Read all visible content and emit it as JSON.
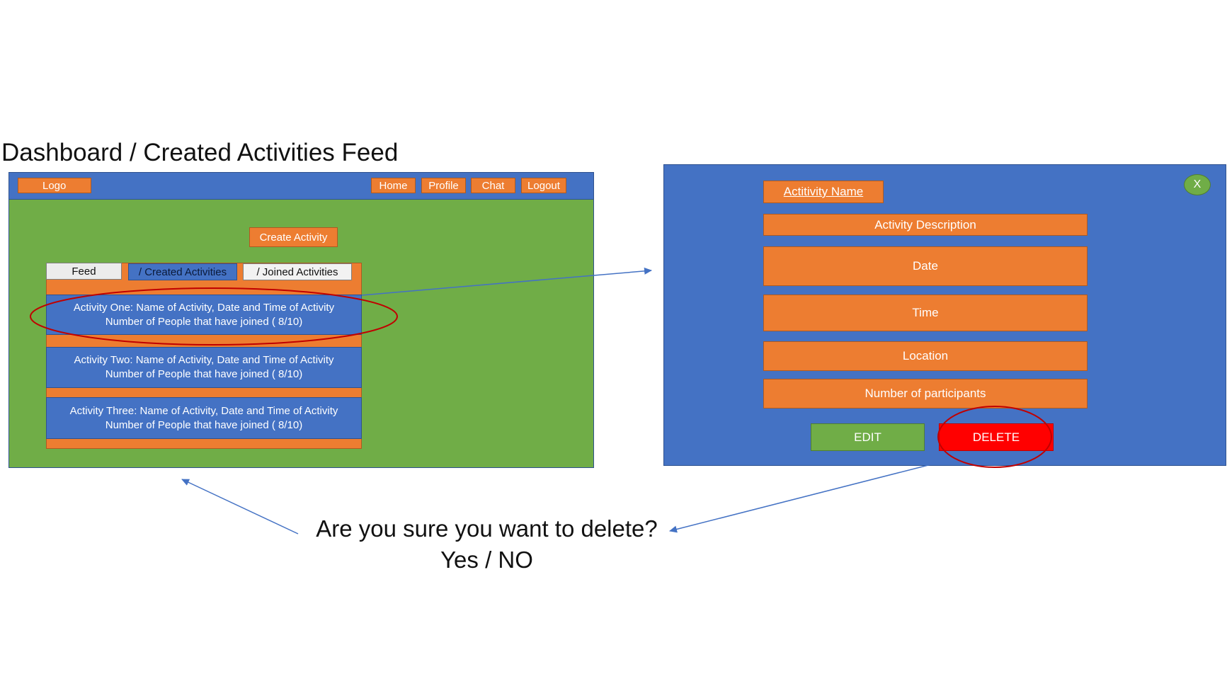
{
  "page_title": "Dashboard / Created Activities Feed",
  "dashboard": {
    "nav": {
      "logo": "Logo",
      "home": "Home",
      "profile": "Profile",
      "chat": "Chat",
      "logout": "Logout"
    },
    "create_activity": "Create Activity",
    "tabs": {
      "feed": "Feed",
      "created": "/ Created Activities",
      "joined": "/ Joined Activities"
    },
    "activities": [
      {
        "title": "Activity One: Name of Activity, Date and Time of Activity",
        "joined": "Number of People that have joined ( 8/10)"
      },
      {
        "title": "Activity Two: Name of Activity, Date and Time of Activity",
        "joined": "Number of People that have joined ( 8/10)"
      },
      {
        "title": "Activity Three: Name of Activity, Date and Time of Activity",
        "joined": "Number of People that have joined ( 8/10)"
      }
    ]
  },
  "modal": {
    "close": "X",
    "activity_name": "Actitivity Name",
    "activity_description": "Activity Description",
    "date": "Date",
    "time": "Time",
    "location": "Location",
    "participants": "Number of participants",
    "edit": "EDIT",
    "delete": "DELETE"
  },
  "confirm": {
    "question": "Are you sure you want to delete?",
    "options": "Yes / NO"
  },
  "colors": {
    "nav_blue": "#4472C4",
    "body_green": "#70AD47",
    "button_orange": "#ED7D31",
    "delete_red": "#FF0000",
    "highlight_red": "#C00000"
  }
}
